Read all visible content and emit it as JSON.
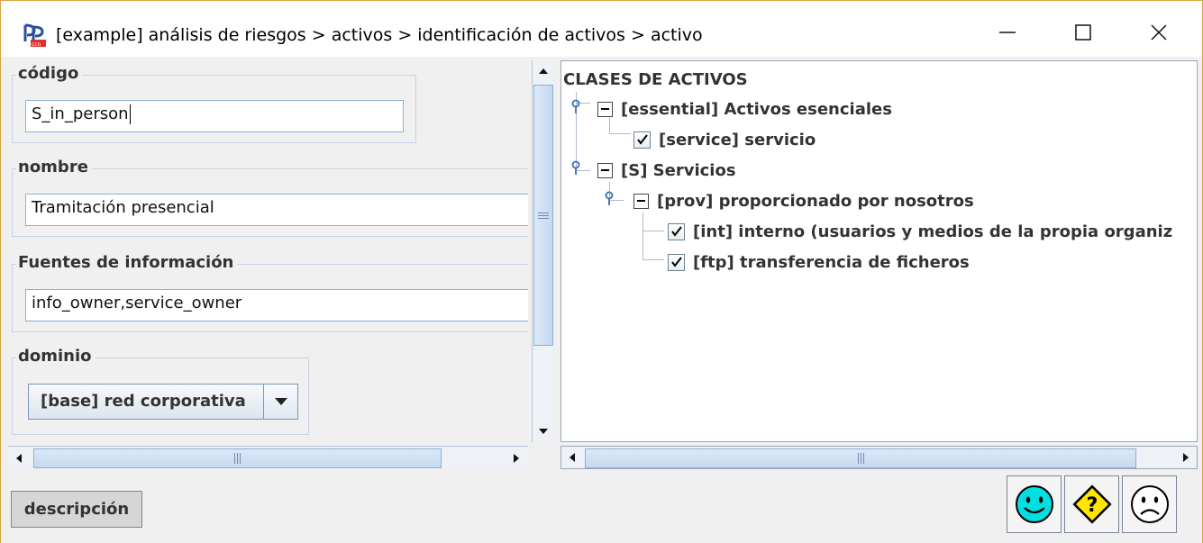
{
  "window": {
    "title": "[example] análisis de riesgos > activos > identificación de activos > activo",
    "minimize_icon": "minimize-icon",
    "maximize_icon": "maximize-icon",
    "close_icon": "close-icon"
  },
  "form": {
    "codigo": {
      "label": "código",
      "value": "S_in_person"
    },
    "nombre": {
      "label": "nombre",
      "value": "Tramitación presencial"
    },
    "fuentes": {
      "label": "Fuentes de información",
      "value": "info_owner,service_owner"
    },
    "dominio": {
      "label": "dominio",
      "selected": "[base] red corporativa"
    }
  },
  "tree": {
    "root": "CLASES DE ACTIVOS",
    "nodes": [
      {
        "label": "[essential] Activos esenciales",
        "kind": "expanded"
      },
      {
        "label": "[service] servicio",
        "kind": "checked"
      },
      {
        "label": "[S] Servicios",
        "kind": "expanded"
      },
      {
        "label": "[prov] proporcionado por nosotros",
        "kind": "expanded"
      },
      {
        "label": "[int] interno (usuarios y medios de la propia organiz",
        "kind": "checked"
      },
      {
        "label": "[ftp] transferencia de ficheros",
        "kind": "checked"
      }
    ]
  },
  "bottom": {
    "description_button": "descripción",
    "ok_icon": "smiley-icon",
    "warning_icon": "question-diamond-icon",
    "cancel_icon": "frown-icon"
  },
  "colors": {
    "window_border": "#d9a441",
    "accent_blue": "#8eafd4",
    "smiley_fill": "#00e0e0",
    "warning_fill": "#ffe600"
  }
}
